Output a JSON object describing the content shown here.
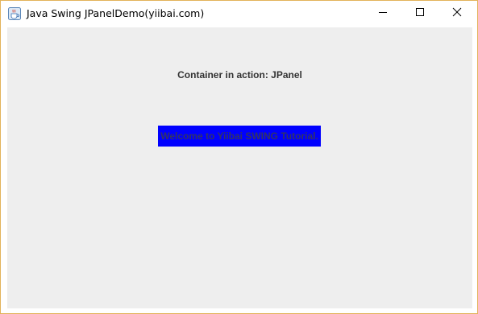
{
  "window": {
    "title": "Java Swing JPanelDemo(yiibai.com)",
    "icon": "java-cup-icon",
    "controls": {
      "minimize": "minimize-icon",
      "maximize": "maximize-icon",
      "close": "close-icon"
    },
    "border_color": "#e3b35a"
  },
  "content": {
    "background": "#eeeeee",
    "header_label": "Container in action: JPanel",
    "panel": {
      "background": "#0000ff",
      "message": "Welcome to Yiibai SWING Tutorial."
    }
  }
}
